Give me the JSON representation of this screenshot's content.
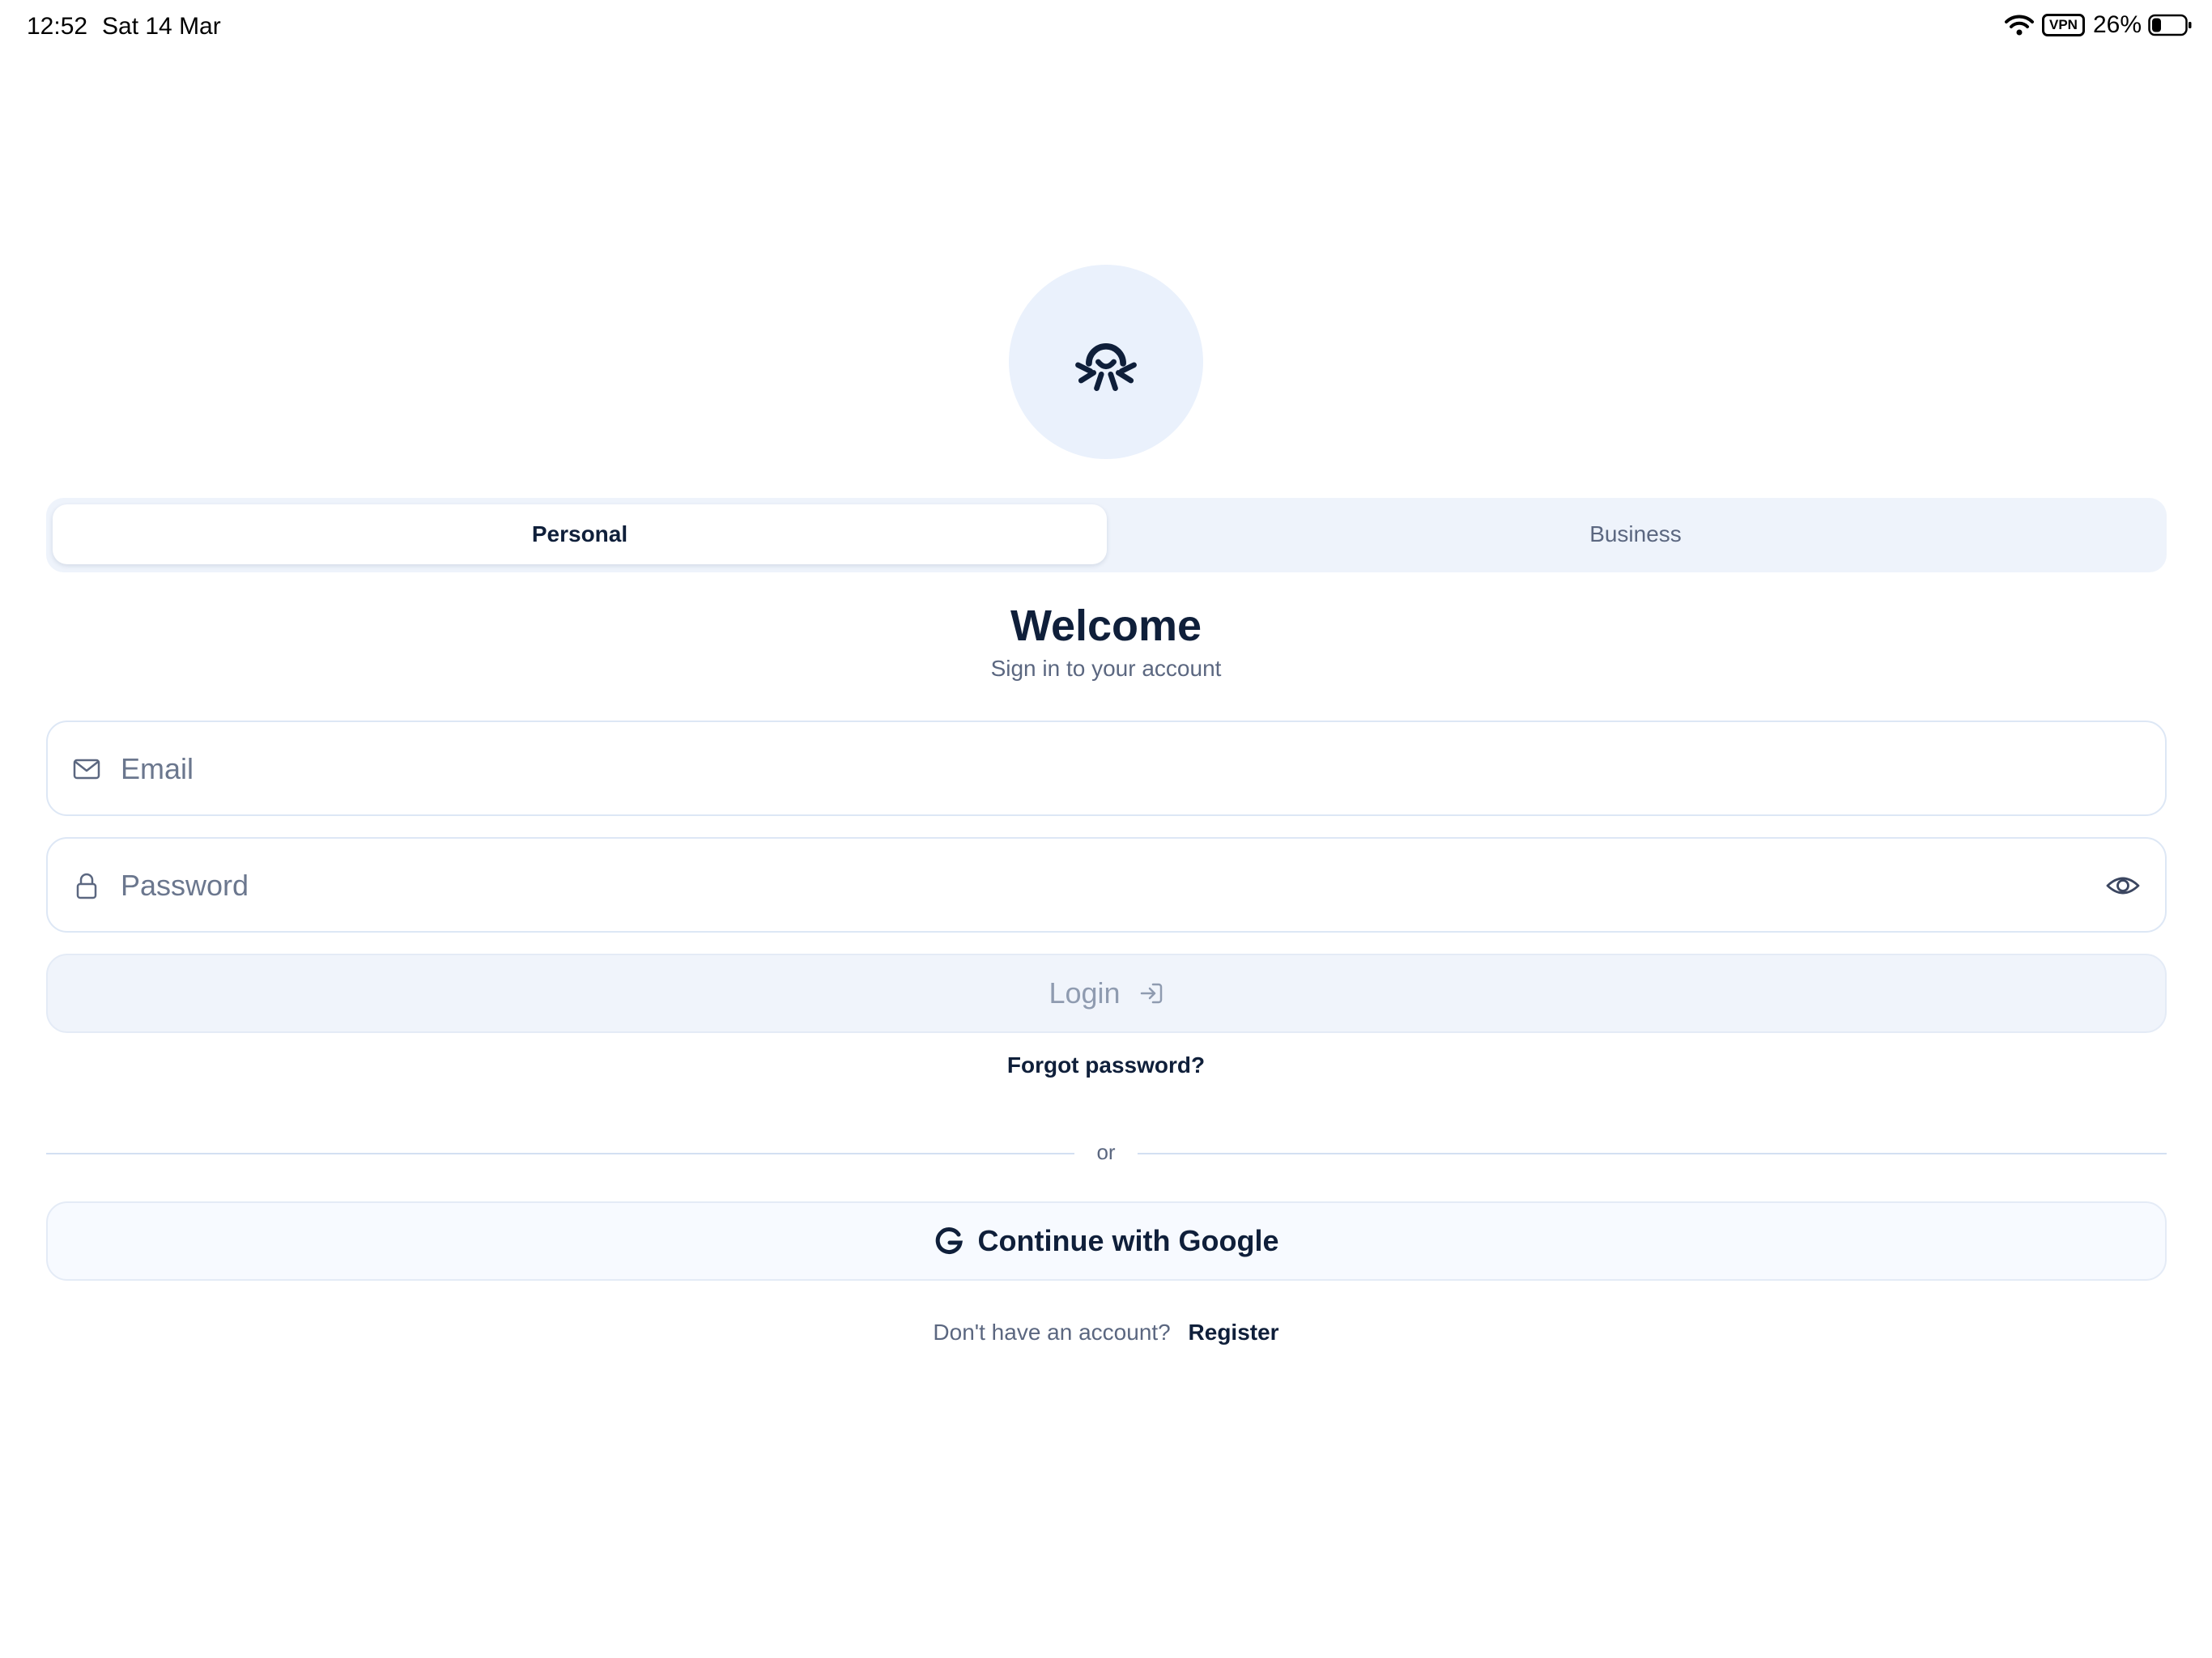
{
  "status_bar": {
    "time": "12:52",
    "date": "Sat 14 Mar",
    "vpn": "VPN",
    "battery": "26%"
  },
  "tabs": {
    "personal": "Personal",
    "business": "Business",
    "selected": "Personal"
  },
  "header": {
    "title": "Welcome",
    "subtitle": "Sign in to your account"
  },
  "form": {
    "email_placeholder": "Email",
    "password_placeholder": "Password",
    "login_label": "Login",
    "forgot_label": "Forgot password?"
  },
  "divider": {
    "text": "or"
  },
  "google": {
    "label": "Continue with Google"
  },
  "register": {
    "prompt": "Don't have an account?",
    "link": "Register"
  },
  "colors": {
    "primary_text": "#0f1f3a",
    "muted_text": "#5b6780",
    "logo_bg": "#eaf1fc",
    "segment_bg": "#eef3fb",
    "border": "#dde7f5"
  }
}
